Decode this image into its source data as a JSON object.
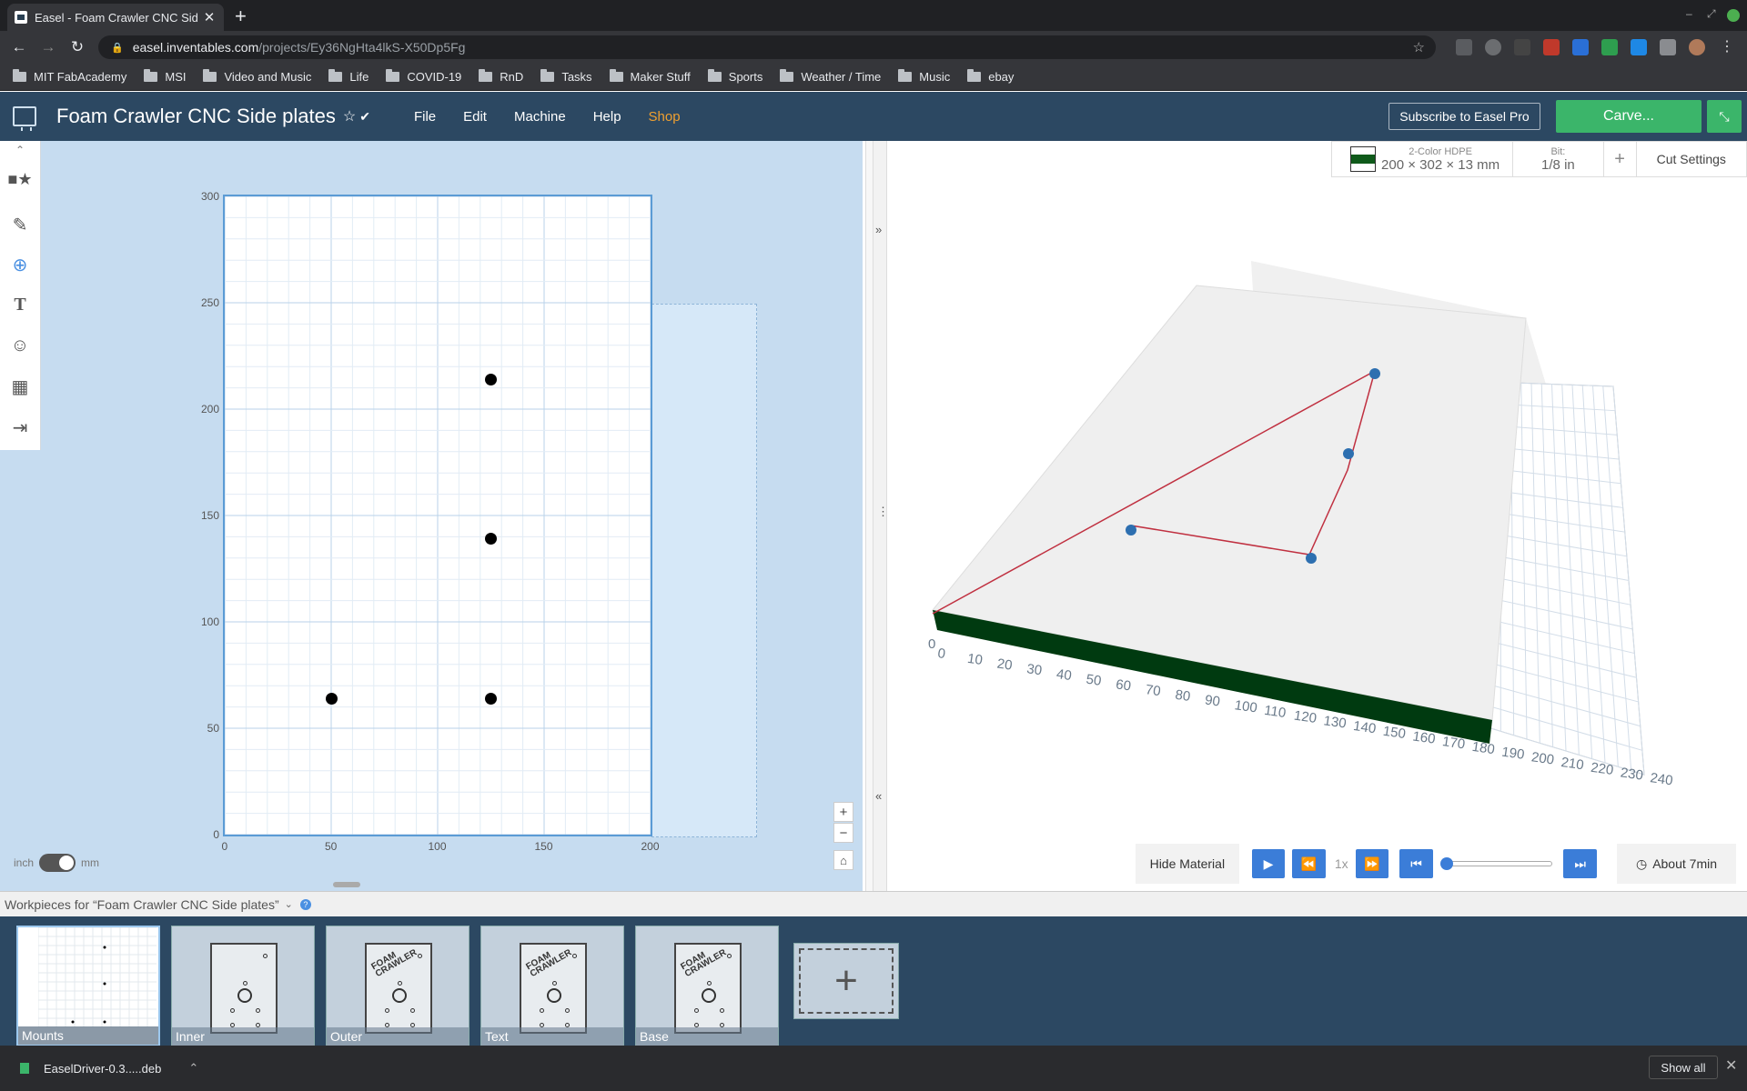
{
  "browser": {
    "tab_title": "Easel - Foam Crawler CNC Sid",
    "url_host": "easel.inventables.com",
    "url_path": "/projects/Ey36NgHta4lkS-X50Dp5Fg",
    "bookmarks": [
      "MIT FabAcademy",
      "MSI",
      "Video and Music",
      "Life",
      "COVID-19",
      "RnD",
      "Tasks",
      "Maker Stuff",
      "Sports",
      "Weather / Time",
      "Music",
      "ebay"
    ]
  },
  "header": {
    "project_title": "Foam Crawler CNC Side plates",
    "menus": [
      "File",
      "Edit",
      "Machine",
      "Help",
      "Shop"
    ],
    "subscribe_label": "Subscribe to Easel Pro",
    "carve_label": "Carve..."
  },
  "design": {
    "y_ticks": [
      "300",
      "250",
      "200",
      "150",
      "100",
      "50",
      "0"
    ],
    "x_ticks": [
      "0",
      "50",
      "100",
      "150",
      "200"
    ],
    "unit_left": "inch",
    "unit_right": "mm",
    "holes_mm": [
      [
        125,
        214
      ],
      [
        125,
        139
      ],
      [
        50,
        64
      ],
      [
        125,
        64
      ]
    ]
  },
  "material": {
    "name": "2-Color HDPE",
    "size": "200 × 302 × 13 mm",
    "bit_label": "Bit:",
    "bit_value": "1/8 in",
    "cut_settings_label": "Cut Settings"
  },
  "preview": {
    "x_ticks": [
      "0",
      "10",
      "20",
      "30",
      "40",
      "50",
      "60",
      "70",
      "80",
      "90",
      "100",
      "110",
      "120",
      "130",
      "140",
      "150",
      "160",
      "170",
      "180",
      "190",
      "200",
      "210",
      "220",
      "230",
      "240"
    ],
    "y_origin_label": "0"
  },
  "playback": {
    "hide_material_label": "Hide Material",
    "speed_label": "1x",
    "progress": 0,
    "time_label": "About 7min"
  },
  "workpieces": {
    "header": "Workpieces for “Foam Crawler CNC Side plates”",
    "items": [
      "Mounts",
      "Inner",
      "Outer",
      "Text",
      "Base"
    ],
    "plate_text": "FOAM CRAWLER"
  },
  "downloads": {
    "file_name": "EaselDriver-0.3.....deb",
    "show_all_label": "Show all"
  }
}
